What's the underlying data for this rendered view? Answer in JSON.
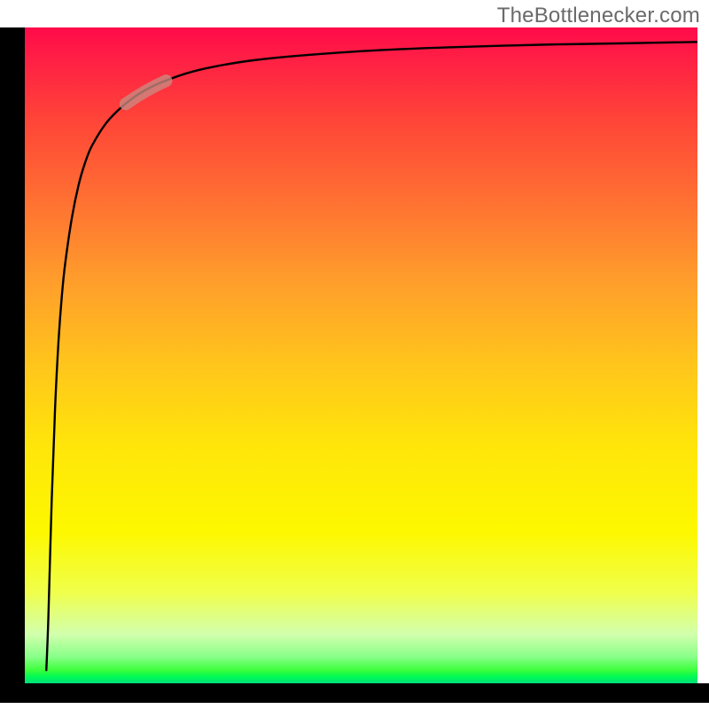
{
  "attribution": "TheBottlenecker.com",
  "colors": {
    "curve": "#000000",
    "marker": "#c98a82",
    "axis": "#000000"
  },
  "chart_data": {
    "type": "line",
    "title": "",
    "xlabel": "",
    "ylabel": "",
    "x_range": [
      0,
      100
    ],
    "y_range": [
      0,
      100
    ],
    "series": [
      {
        "name": "bottleneck-curve",
        "x": [
          3.2,
          3.5,
          4.0,
          4.5,
          5.0,
          5.5,
          6.0,
          7.0,
          8.0,
          9.0,
          10.0,
          12.0,
          14.0,
          16.0,
          18.0,
          20.0,
          24.0,
          28.0,
          34.0,
          42.0,
          52.0,
          64.0,
          78.0,
          90.0,
          100.0
        ],
        "y": [
          2.0,
          10.0,
          28.0,
          42.0,
          52.0,
          59.0,
          64.0,
          71.0,
          76.0,
          79.5,
          82.0,
          85.3,
          87.5,
          89.2,
          90.5,
          91.5,
          93.0,
          94.0,
          95.0,
          95.8,
          96.5,
          97.0,
          97.4,
          97.6,
          97.8
        ]
      }
    ],
    "marker": {
      "note": "highlighted segment on curve",
      "x": 18.0,
      "y": 88.0,
      "length_approx_pct": 6
    },
    "background_gradient": {
      "direction": "vertical",
      "stops": [
        {
          "pos": 0.0,
          "color": "#ff0b4a"
        },
        {
          "pos": 0.5,
          "color": "#ffc41c"
        },
        {
          "pos": 0.8,
          "color": "#fdf800"
        },
        {
          "pos": 0.96,
          "color": "#88ff88"
        },
        {
          "pos": 1.0,
          "color": "#00e07a"
        }
      ]
    }
  }
}
